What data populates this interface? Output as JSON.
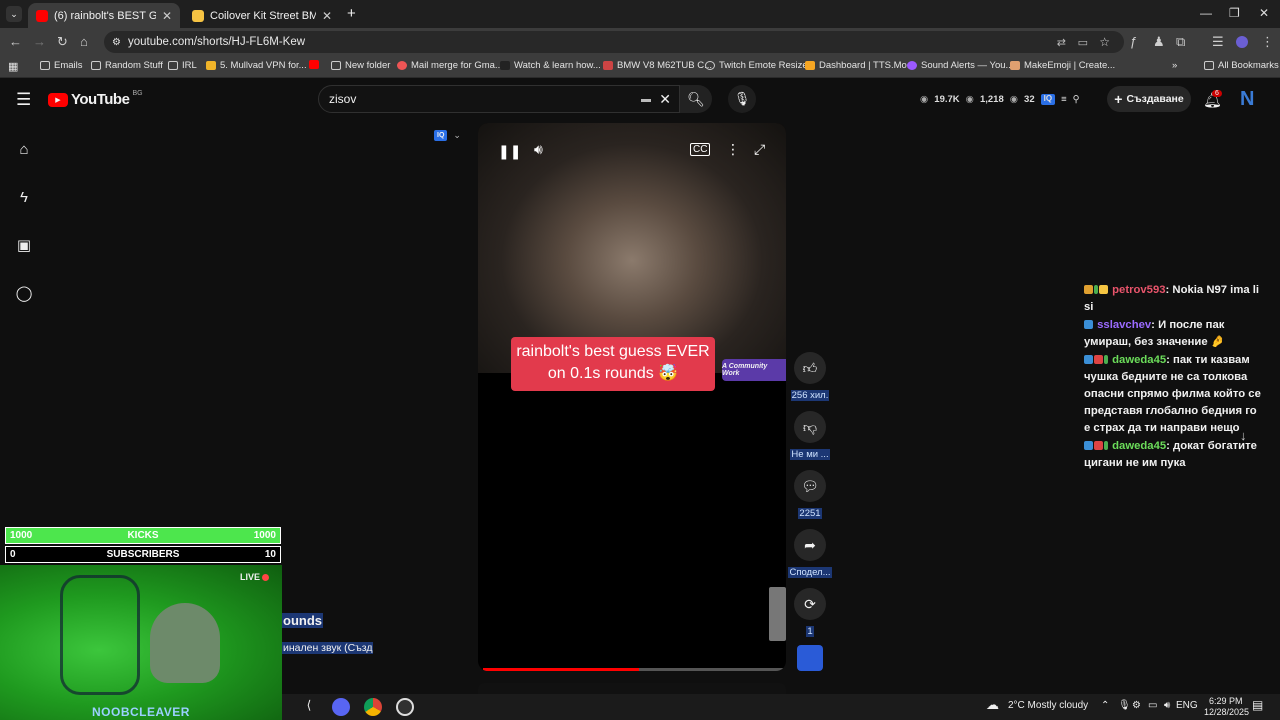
{
  "browser": {
    "tabs": [
      {
        "title": "(6) rainbolt's BEST GUESSES",
        "active": true
      },
      {
        "title": "Coilover Kit Street BMW 7 (E38)",
        "active": false
      }
    ],
    "url": "youtube.com/shorts/HJ-FL6M-Kew",
    "bookmarks": [
      "Emails",
      "Random Stuff",
      "IRL",
      "5. Mullvad VPN for...",
      "New folder",
      "Mail merge for Gma...",
      "Watch & learn how...",
      "BMW V8 M62TUB C...",
      "Twitch Emote Resizer",
      "Dashboard | TTS.Mo...",
      "Sound Alerts — You...",
      "MakeEmoji | Create..."
    ],
    "all_bookmarks": "All Bookmarks"
  },
  "youtube": {
    "logo": "YouTube",
    "region": "BG",
    "search_value": "zisov",
    "stats": {
      "a": "19.7K",
      "b": "1,218",
      "c": "32"
    },
    "create_label": "Създаване",
    "notif_count": "6",
    "avatar_letter": "N"
  },
  "short": {
    "caption_line1": "rainbolt's best guess EVER",
    "caption_line2": "on 0.1s rounds 🤯",
    "community_badge": "A Community Work",
    "progress": 0.52,
    "like_count": "256 хил.",
    "dislike_label": "Не ми ...",
    "comments_count": "2251",
    "share_label": "Сподел...",
    "remix_count": "1"
  },
  "overlay": {
    "kicks_left": "1000",
    "kicks_label": "KICKS",
    "kicks_right": "1000",
    "subs_left": "0",
    "subs_label": "SUBSCRIBERS",
    "subs_right": "10",
    "live_label": "LIVE",
    "streamer": "NOOBCLEAVER",
    "partial_title": "ounds",
    "partial_sound": "инален звук (Създ"
  },
  "chat": [
    {
      "user": "petrov593",
      "color": "#e8546b",
      "text": ": Nokia N97 ima li si"
    },
    {
      "user": "sslavchev",
      "color": "#9b6bff",
      "text": ": И после пак умираш, без значение 🤌"
    },
    {
      "user": "daweda45",
      "color": "#6bdc5a",
      "text": ": пак ти казвам чушка бедните не са толкова опасни спрямо филма който се представя глобално бедния го е страх да ти направи нещо"
    },
    {
      "user": "daweda45",
      "color": "#6bdc5a",
      "text": ": докат богатите цигани не им пука"
    }
  ],
  "taskbar": {
    "weather": "2°C  Mostly cloudy",
    "lang": "ENG",
    "time": "6:29 PM",
    "date": "12/28/2025"
  }
}
